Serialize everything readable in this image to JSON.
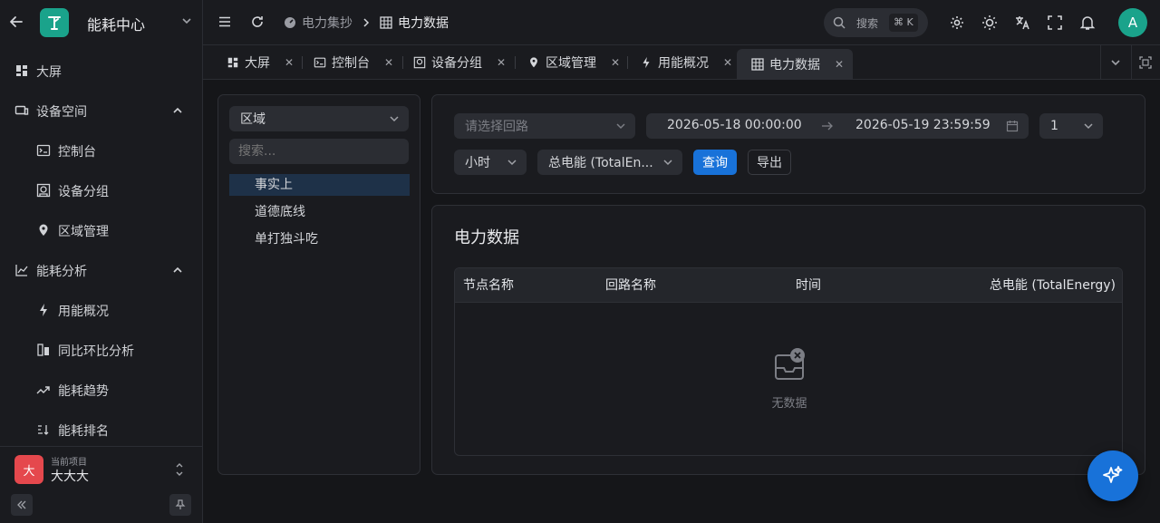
{
  "app": {
    "title": "能耗中心"
  },
  "sidebar": {
    "items": [
      {
        "label": "大屏",
        "icon": "dashboard-icon"
      },
      {
        "label": "设备空间",
        "icon": "devices-icon",
        "expanded": true
      },
      {
        "label": "控制台",
        "icon": "terminal-icon"
      },
      {
        "label": "设备分组",
        "icon": "group-icon"
      },
      {
        "label": "区域管理",
        "icon": "location-pin-icon"
      },
      {
        "label": "能耗分析",
        "icon": "chart-line-icon",
        "expanded": true
      },
      {
        "label": "用能概况",
        "icon": "lightning-icon"
      },
      {
        "label": "同比环比分析",
        "icon": "compare-icon"
      },
      {
        "label": "能耗趋势",
        "icon": "trend-icon"
      },
      {
        "label": "能耗排名",
        "icon": "ranking-icon"
      }
    ],
    "project": {
      "caption": "当前项目",
      "name": "大大大",
      "avatar": "大"
    }
  },
  "header": {
    "breadcrumb": [
      {
        "label": "电力集抄"
      },
      {
        "label": "电力数据"
      }
    ],
    "search": {
      "label": "搜索",
      "shortcut": "⌘ K"
    },
    "avatar": "A"
  },
  "tabs": [
    {
      "label": "大屏"
    },
    {
      "label": "控制台"
    },
    {
      "label": "设备分组"
    },
    {
      "label": "区域管理"
    },
    {
      "label": "用能概况"
    },
    {
      "label": "电力数据",
      "active": true
    }
  ],
  "tree": {
    "filter_value": "区域",
    "search_placeholder": "搜索...",
    "items": [
      {
        "label": "事实上",
        "selected": true
      },
      {
        "label": "道德底线"
      },
      {
        "label": "单打独斗吃"
      }
    ]
  },
  "filters": {
    "circuit_placeholder": "请选择回路",
    "start_time": "2026-05-18 00:00:00",
    "end_time": "2026-05-19 23:59:59",
    "interval_value": "1",
    "unit_value": "小时",
    "metric_value": "总电能 (TotalEn...",
    "query_label": "查询",
    "export_label": "导出"
  },
  "table": {
    "title": "电力数据",
    "columns": [
      "节点名称",
      "回路名称",
      "时间",
      "总电能 (TotalEnergy)"
    ],
    "rows": [],
    "empty_text": "无数据"
  },
  "colors": {
    "accent": "#1872d9",
    "brand": "#1aa38b",
    "project_avatar": "#e5484d"
  }
}
